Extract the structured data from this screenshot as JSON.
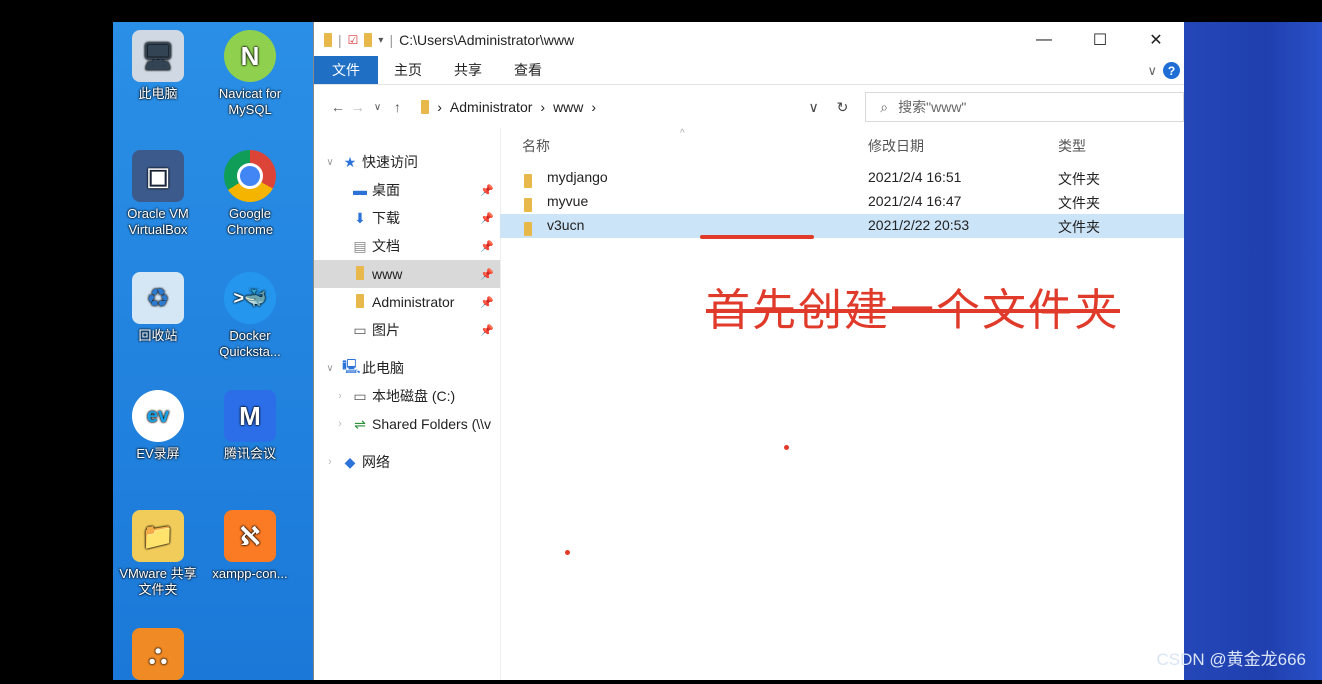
{
  "desktop": {
    "icons": [
      {
        "label": "此电脑",
        "icon": "computer-icon"
      },
      {
        "label": "Navicat for MySQL",
        "icon": "navicat-icon"
      },
      {
        "label": "Oracle VM VirtualBox",
        "icon": "virtualbox-icon"
      },
      {
        "label": "Google Chrome",
        "icon": "chrome-icon"
      },
      {
        "label": "回收站",
        "icon": "recycle-bin-icon"
      },
      {
        "label": "Docker Quicksta...",
        "icon": "docker-icon"
      },
      {
        "label": "EV录屏",
        "icon": "ev-recorder-icon"
      },
      {
        "label": "腾讯会议",
        "icon": "tencent-meeting-icon"
      },
      {
        "label": "VMware 共享 文件夹",
        "icon": "shared-folder-icon"
      },
      {
        "label": "xampp-con...",
        "icon": "xampp-icon"
      }
    ],
    "watermark": "CSDN @黄金龙666"
  },
  "window": {
    "title_path": "C:\\Users\\Administrator\\www",
    "controls": {
      "minimize": "—",
      "maximize": "☐",
      "close": "✕"
    },
    "ribbon_tabs": [
      "文件",
      "主页",
      "共享",
      "查看"
    ],
    "address_path": [
      "Administrator",
      "www"
    ],
    "search_placeholder": "搜索\"www\"",
    "nav_pane": {
      "quick_access": "快速访问",
      "quick_items": [
        "桌面",
        "下载",
        "文档",
        "www",
        "Administrator",
        "图片"
      ],
      "this_pc": "此电脑",
      "pc_items": [
        "本地磁盘 (C:)",
        "Shared Folders (\\\\v"
      ],
      "network": "网络"
    },
    "columns": {
      "name": "名称",
      "modified": "修改日期",
      "type": "类型"
    },
    "files": [
      {
        "name": "mydjango",
        "modified": "2021/2/4 16:51",
        "type": "文件夹"
      },
      {
        "name": "myvue",
        "modified": "2021/2/4 16:47",
        "type": "文件夹"
      },
      {
        "name": "v3ucn",
        "modified": "2021/2/22 20:53",
        "type": "文件夹"
      }
    ]
  },
  "annotation": {
    "text": "首先创建一个文件夹",
    "color": "#e03a2a"
  }
}
